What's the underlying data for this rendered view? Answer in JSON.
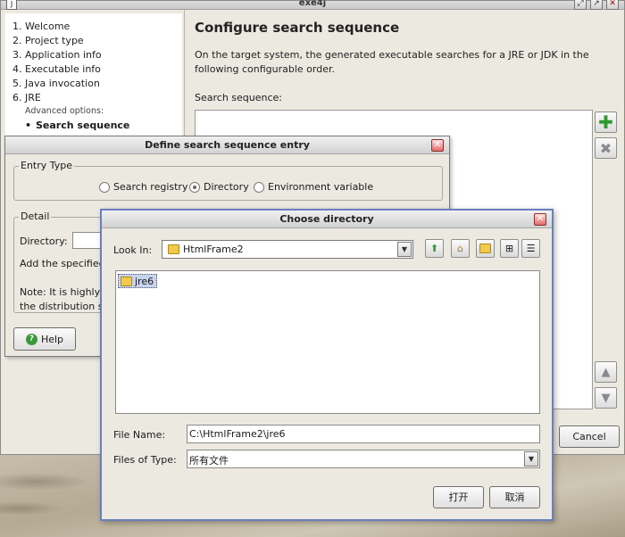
{
  "window": {
    "title": "exe4j",
    "minimize": "⤢",
    "maximize": "↗",
    "close": "✕"
  },
  "steps": {
    "items": [
      "1. Welcome",
      "2. Project type",
      "3. Application info",
      "4. Executable info",
      "5. Java invocation",
      "6. JRE"
    ],
    "advanced_label": "Advanced options:",
    "current_bullet": "•",
    "current": "Search sequence"
  },
  "page": {
    "title": "Configure search sequence",
    "description": "On the target system, the generated executable searches for a JRE or JDK in the following configurable order.",
    "sequence_label": "Search sequence:",
    "cancel": "Cancel"
  },
  "entry_dialog": {
    "title": "Define search sequence entry",
    "entry_type_label": "Entry Type",
    "options": [
      "Search registry",
      "Directory",
      "Environment variable"
    ],
    "selected_option": "Directory",
    "detail_label": "Detail",
    "directory_label": "Directory:",
    "add_text": "Add the specified d",
    "note_line_1": "Note: It is highly rec",
    "note_line_2": "the distribution sou",
    "help": "Help",
    "help_icon_glyph": "?"
  },
  "chooser": {
    "title": "Choose directory",
    "look_in_label": "Look In:",
    "look_in_value": "HtmlFrame2",
    "files": [
      "jre6"
    ],
    "file_name_label": "File Name:",
    "file_name_value": "C:\\HtmlFrame2\\jre6",
    "files_of_type_label": "Files of Type:",
    "files_of_type_value": "所有文件",
    "open": "打开",
    "cancel": "取消"
  },
  "icons": {
    "add": "add-icon",
    "remove": "remove-icon",
    "move_up": "arrow-up-icon",
    "move_down": "arrow-down-icon",
    "up_folder": "up-folder-icon",
    "home": "home-icon",
    "new_folder": "new-folder-icon",
    "list_view": "list-view-icon",
    "details_view": "details-view-icon"
  },
  "colors": {
    "add_green": "#2e9a2e",
    "selection": "#c9d3ec",
    "dialog_border": "#6a7fbf"
  }
}
